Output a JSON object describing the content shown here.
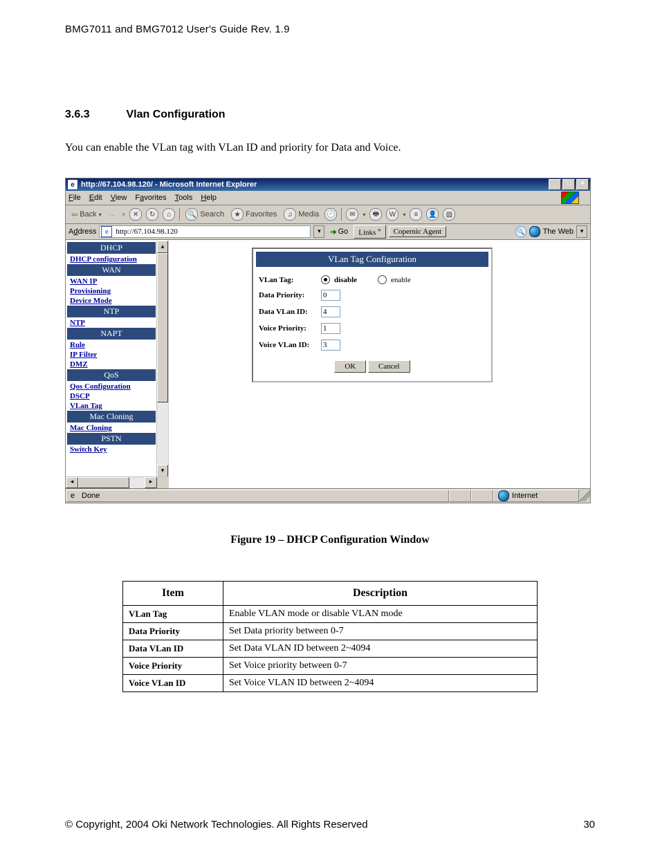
{
  "doc": {
    "header": "BMG7011 and BMG7012 User's Guide Rev. 1.9",
    "section_number": "3.6.3",
    "section_title": "Vlan Configuration",
    "intro": "You can enable the VLan tag with VLan ID and priority for Data and Voice.",
    "figure_caption": "Figure 19 – DHCP Configuration Window",
    "footer_copyright": "© Copyright, 2004 Oki Network Technologies. All Rights Reserved",
    "footer_page": "30"
  },
  "browser": {
    "title": "http://67.104.98.120/ - Microsoft Internet Explorer",
    "menus": {
      "file": "File",
      "edit": "Edit",
      "view": "View",
      "favorites": "Favorites",
      "tools": "Tools",
      "help": "Help"
    },
    "toolbar": {
      "back": "Back",
      "search": "Search",
      "favorites": "Favorites",
      "media": "Media"
    },
    "address_label": "Address",
    "address_value": "http://67.104.98.120",
    "go_label": "Go",
    "links_label": "Links",
    "copernic_label": "Copernic Agent",
    "theweb_label": "The Web",
    "status_done": "Done",
    "status_zone": "Internet"
  },
  "sidebar": {
    "groups": [
      {
        "header": "DHCP",
        "links": [
          {
            "t": "DHCP configuration",
            "b": true
          }
        ]
      },
      {
        "header": "WAN",
        "links": [
          {
            "t": "WAN IP",
            "b": true
          },
          {
            "t": "Provisioning",
            "b": true
          },
          {
            "t": "Device Mode",
            "b": true
          }
        ]
      },
      {
        "header": "NTP",
        "links": [
          {
            "t": "NTP",
            "b": true
          }
        ]
      },
      {
        "header": "NAPT",
        "links": [
          {
            "t": "Rule",
            "b": true
          },
          {
            "t": "IP Filter",
            "b": true
          },
          {
            "t": "DMZ",
            "b": true
          }
        ]
      },
      {
        "header": "QoS",
        "links": [
          {
            "t": "Qos Configuration",
            "b": true
          },
          {
            "t": "DSCP",
            "b": true
          },
          {
            "t": "VLan Tag",
            "b": true
          }
        ]
      },
      {
        "header": "Mac Cloning",
        "links": [
          {
            "t": "Mac Cloning",
            "b": true
          }
        ]
      },
      {
        "header": "PSTN",
        "links": [
          {
            "t": "Switch Key",
            "b": true,
            "cut": true
          }
        ]
      }
    ]
  },
  "config": {
    "panel_title": "VLan Tag Configuration",
    "row_tag_label": "VLan Tag:",
    "opt_disable": "disable",
    "opt_enable": "enable",
    "row_dataprio_label": "Data Priority:",
    "val_dataprio": "0",
    "row_datavlan_label": "Data VLan ID:",
    "val_datavlan": "4",
    "row_voiceprio_label": "Voice Priority:",
    "val_voiceprio": "1",
    "row_voicevlan_label": "Voice VLan ID:",
    "val_voicevlan": "3",
    "btn_ok": "OK",
    "btn_cancel": "Cancel"
  },
  "table": {
    "h_item": "Item",
    "h_desc": "Description",
    "rows": [
      {
        "item": "VLan Tag",
        "desc": "Enable VLAN mode or disable VLAN mode"
      },
      {
        "item": "Data Priority",
        "desc": "Set Data priority between 0-7"
      },
      {
        "item": "Data VLan ID",
        "desc": "Set Data VLAN ID between 2~4094"
      },
      {
        "item": "Voice Priority",
        "desc": "Set Voice priority between 0-7"
      },
      {
        "item": "Voice VLan ID",
        "desc": "Set Voice VLAN ID between 2~4094"
      }
    ]
  }
}
